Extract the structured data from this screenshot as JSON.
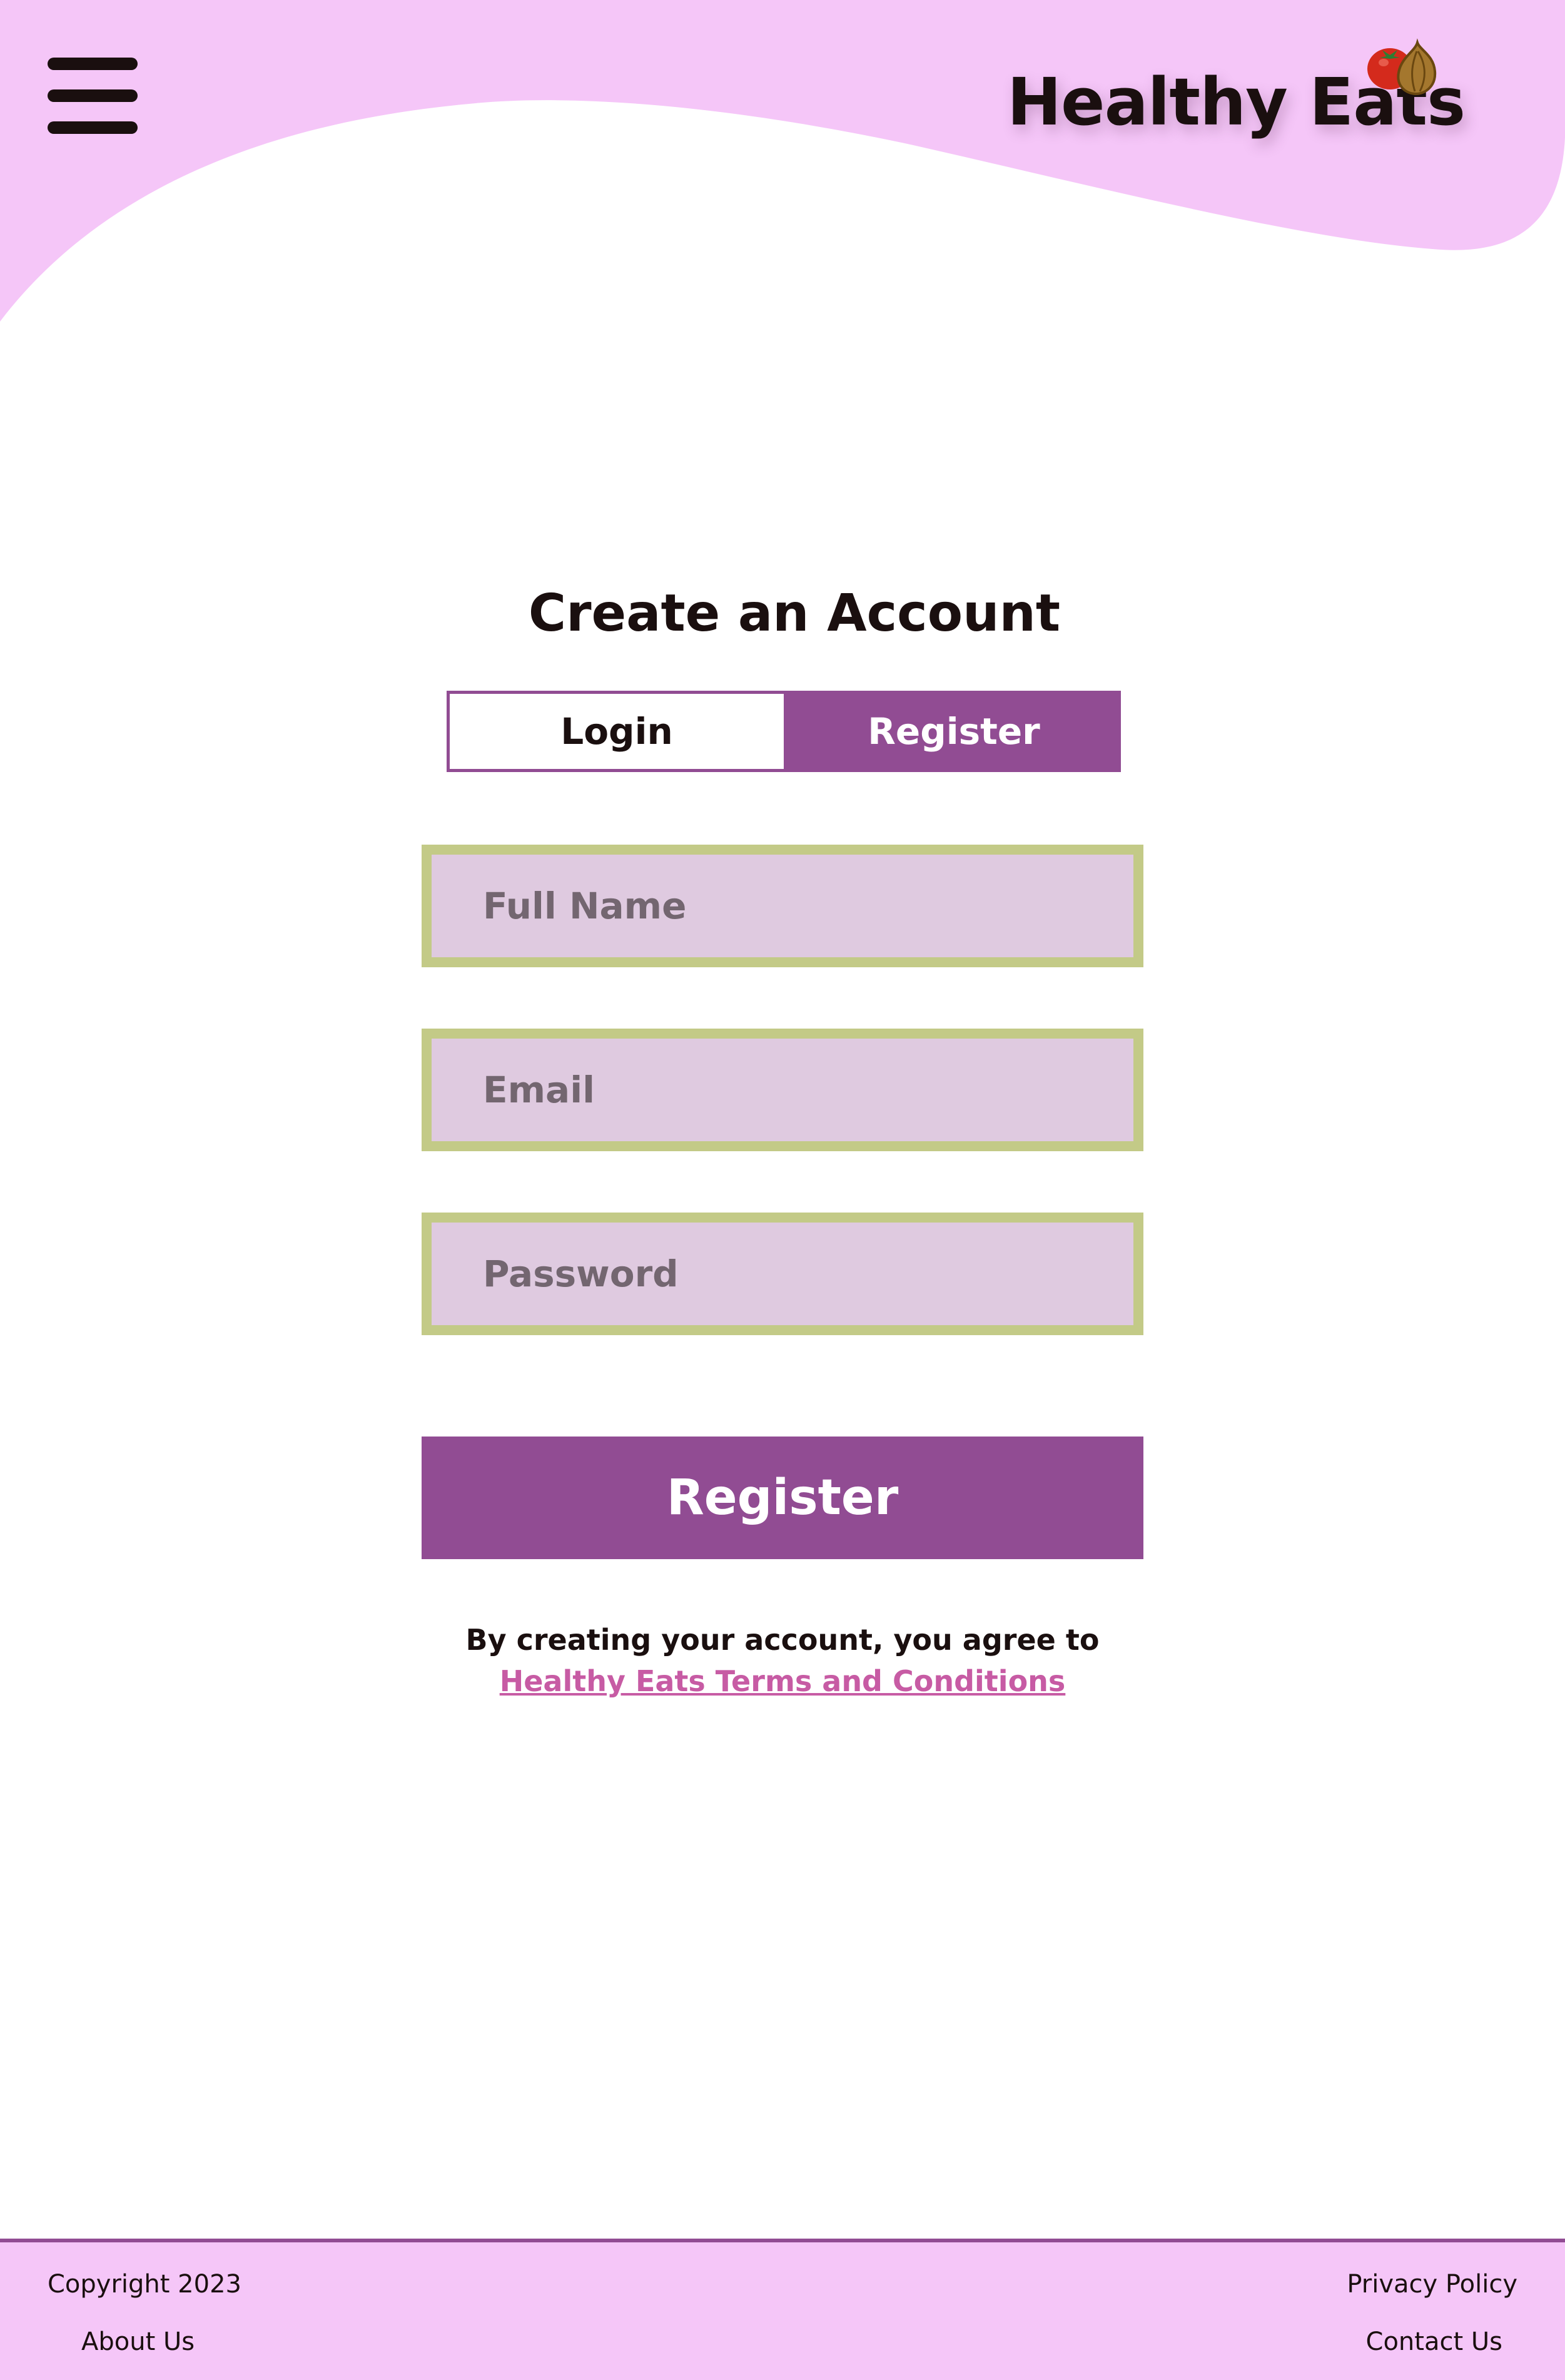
{
  "header": {
    "logo_text": "Healthy Eats",
    "logo_icons": [
      "tomato-icon",
      "onion-icon"
    ],
    "menu_icon": "hamburger-menu-icon"
  },
  "form": {
    "title": "Create an Account",
    "tabs": [
      {
        "label": "Login",
        "active": false
      },
      {
        "label": "Register",
        "active": true
      }
    ],
    "fields": {
      "full_name": {
        "placeholder": "Full Name",
        "value": ""
      },
      "email": {
        "placeholder": "Email",
        "value": ""
      },
      "password": {
        "placeholder": "Password",
        "value": ""
      }
    },
    "submit_label": "Register",
    "terms": {
      "prefix": "By creating your account, you agree to ",
      "link_text": "Healthy Eats Terms and Conditions"
    }
  },
  "footer": {
    "copyright": "Copyright 2023",
    "about": "About Us",
    "privacy": "Privacy Policy",
    "contact": "Contact Us"
  },
  "colors": {
    "accent": "#914c93",
    "header_pink": "#f5c6f8",
    "field_fill": "#dfcae0",
    "field_border": "#c3ca87",
    "link_pink": "#c75ba4",
    "text_dark": "#1a0f0f"
  }
}
